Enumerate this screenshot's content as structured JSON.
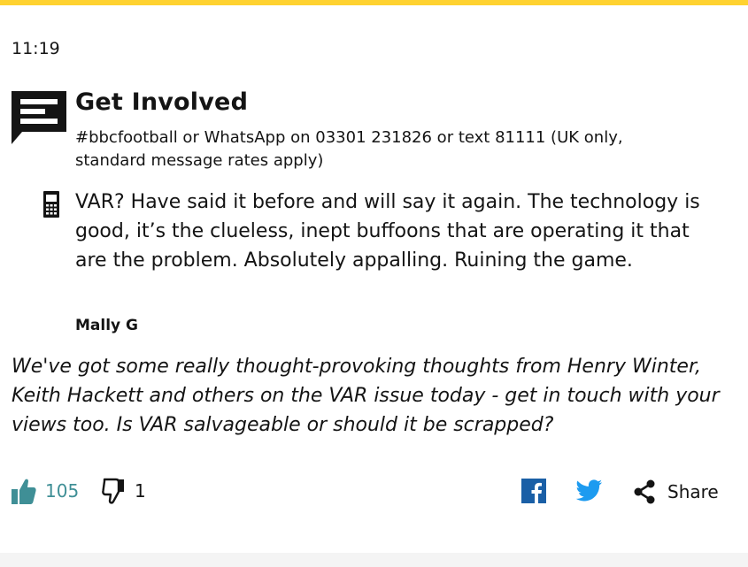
{
  "post": {
    "time": "11:19",
    "get_involved": {
      "title": "Get Involved",
      "subtitle": "#bbcfootball or WhatsApp on 03301 231826 or text 81111 (UK only, standard message rates apply)"
    },
    "message": {
      "icon": "mobile-phone-icon",
      "text": "VAR? Have said it before and will say it again. The technology is good, it’s the clueless, inept buffoons that are operating it that are the problem. Absolutely appalling. Ruining the game.",
      "author": "Mally G"
    },
    "commentary": "We've got some really thought-provoking thoughts from Henry Winter, Keith Hackett and others on the VAR issue today - get in touch with your views too. Is VAR salvageable or should it be scrapped?"
  },
  "reactions": {
    "likes": "105",
    "dislikes": "1"
  },
  "share": {
    "label": "Share",
    "facebook_icon": "facebook-icon",
    "twitter_icon": "twitter-icon"
  },
  "colors": {
    "accent_bar": "#ffd230",
    "like": "#3f8f96",
    "facebook": "#1a5fa6",
    "twitter": "#1d9bf0",
    "text": "#141414"
  }
}
